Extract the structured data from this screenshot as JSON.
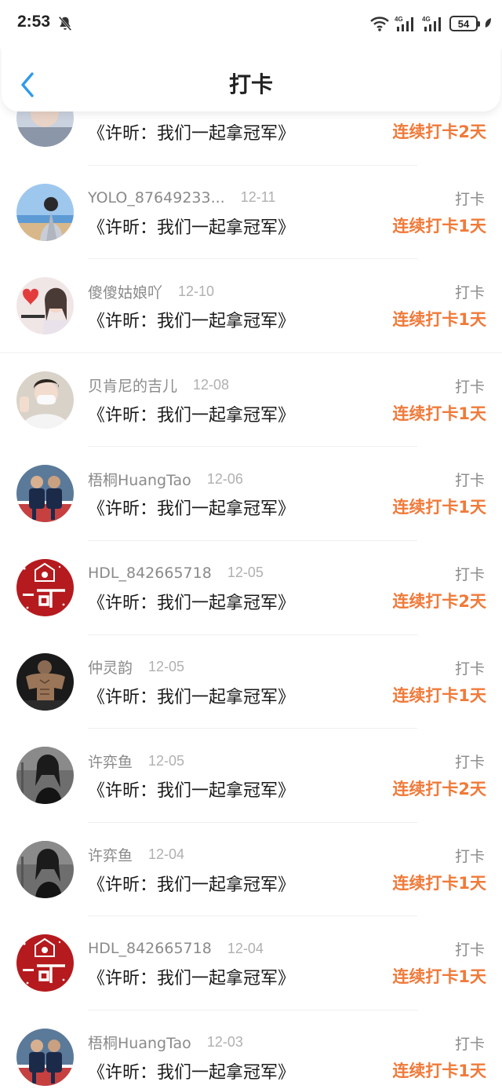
{
  "status_bar": {
    "time": "2:53",
    "battery": "54",
    "network_1": "4G",
    "network_2": "4G"
  },
  "header": {
    "title": "打卡"
  },
  "records": [
    {
      "user": "",
      "date": "",
      "book": "《许昕：我们一起拿冠军》",
      "action": "",
      "streak": "连续打卡2天",
      "avatar": "partial"
    },
    {
      "user": "YOLO_87649233...",
      "date": "12-11",
      "book": "《许昕：我们一起拿冠军》",
      "action": "打卡",
      "streak": "连续打卡1天",
      "avatar": "beach"
    },
    {
      "user": "傻傻姑娘吖",
      "date": "12-10",
      "book": "《许昕：我们一起拿冠军》",
      "action": "打卡",
      "streak": "连续打卡1天",
      "avatar": "girl"
    },
    {
      "user": "贝肯尼的吉儿",
      "date": "12-08",
      "book": "《许昕：我们一起拿冠军》",
      "action": "打卡",
      "streak": "连续打卡1天",
      "avatar": "mask"
    },
    {
      "user": "梧桐HuangTao",
      "date": "12-06",
      "book": "《许昕：我们一起拿冠军》",
      "action": "打卡",
      "streak": "连续打卡1天",
      "avatar": "players"
    },
    {
      "user": "HDL_842665718",
      "date": "12-05",
      "book": "《许昕：我们一起拿冠军》",
      "action": "打卡",
      "streak": "连续打卡2天",
      "avatar": "red"
    },
    {
      "user": "仲灵韵",
      "date": "12-05",
      "book": "《许昕：我们一起拿冠军》",
      "action": "打卡",
      "streak": "连续打卡1天",
      "avatar": "muscle"
    },
    {
      "user": "许弈鱼",
      "date": "12-05",
      "book": "《许昕：我们一起拿冠军》",
      "action": "打卡",
      "streak": "连续打卡2天",
      "avatar": "dark"
    },
    {
      "user": "许弈鱼",
      "date": "12-04",
      "book": "《许昕：我们一起拿冠军》",
      "action": "打卡",
      "streak": "连续打卡1天",
      "avatar": "dark"
    },
    {
      "user": "HDL_842665718",
      "date": "12-04",
      "book": "《许昕：我们一起拿冠军》",
      "action": "打卡",
      "streak": "连续打卡1天",
      "avatar": "red"
    },
    {
      "user": "梧桐HuangTao",
      "date": "12-03",
      "book": "《许昕：我们一起拿冠军》",
      "action": "打卡",
      "streak": "连续打卡1天",
      "avatar": "players"
    }
  ],
  "colors": {
    "accent": "#f07a3a",
    "back_icon": "#2f9bea",
    "muted_text": "#8a8a8a"
  },
  "icons": {
    "back": "chevron-left-icon",
    "mute": "bell-off-icon",
    "wifi": "wifi-icon",
    "signal": "signal-icon",
    "battery": "battery-icon"
  }
}
